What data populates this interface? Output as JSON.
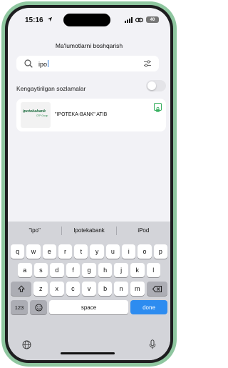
{
  "status": {
    "time": "15:16",
    "battery": "40"
  },
  "page": {
    "title": "Ma'lumotlarni boshqarish"
  },
  "search": {
    "value": "ipo"
  },
  "advanced": {
    "label": "Kengaytirilgan sozlamalar"
  },
  "result": {
    "logo_text": "ipotekabank",
    "logo_sub": "OTP Group",
    "name": "\"IPOTEKA-BANK\" ATIB"
  },
  "keyboard": {
    "suggestions": [
      "\"ipo\"",
      "Ipotekabank",
      "iPod"
    ],
    "row1": [
      "q",
      "w",
      "e",
      "r",
      "t",
      "y",
      "u",
      "i",
      "o",
      "p"
    ],
    "row2": [
      "a",
      "s",
      "d",
      "f",
      "g",
      "h",
      "j",
      "k",
      "l"
    ],
    "row3": [
      "z",
      "x",
      "c",
      "v",
      "b",
      "n",
      "m"
    ],
    "numbers": "123",
    "space": "space",
    "done": "done"
  },
  "colors": {
    "accent": "#2d8cf0",
    "frame": "#8fc7a0",
    "bank_green": "#1b6b3d"
  }
}
